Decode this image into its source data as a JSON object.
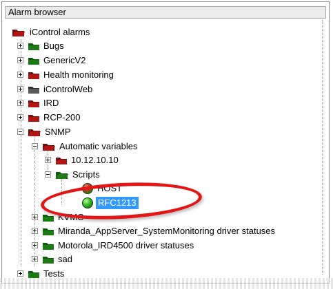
{
  "panel": {
    "title": "Alarm browser"
  },
  "tree": {
    "root": "iControl alarms",
    "level1": [
      "Bugs",
      "GenericV2",
      "Health monitoring",
      "iControlWeb",
      "IRD",
      "RCP-200",
      "SNMP"
    ],
    "snmp_children": {
      "automatic_variables": "Automatic variables",
      "auto_children": [
        "10.12.10.10",
        "Scripts"
      ],
      "scripts_children": [
        "HOST",
        "RFC1213"
      ],
      "other": [
        "KVMC",
        "Miranda_AppServer_SystemMonitoring driver statuses",
        "Motorola_IRD4500 driver statuses",
        "sad"
      ]
    },
    "tail": [
      "Tests"
    ]
  },
  "colors": {
    "red_folder": "#8b0f0f",
    "green_folder": "#0f5a0c",
    "gray_folder": "#4a4a4a",
    "selection": "#3399ff",
    "callout": "#e31616"
  },
  "icons": {
    "folder": "folder-icon",
    "orb": "status-orb-icon"
  }
}
